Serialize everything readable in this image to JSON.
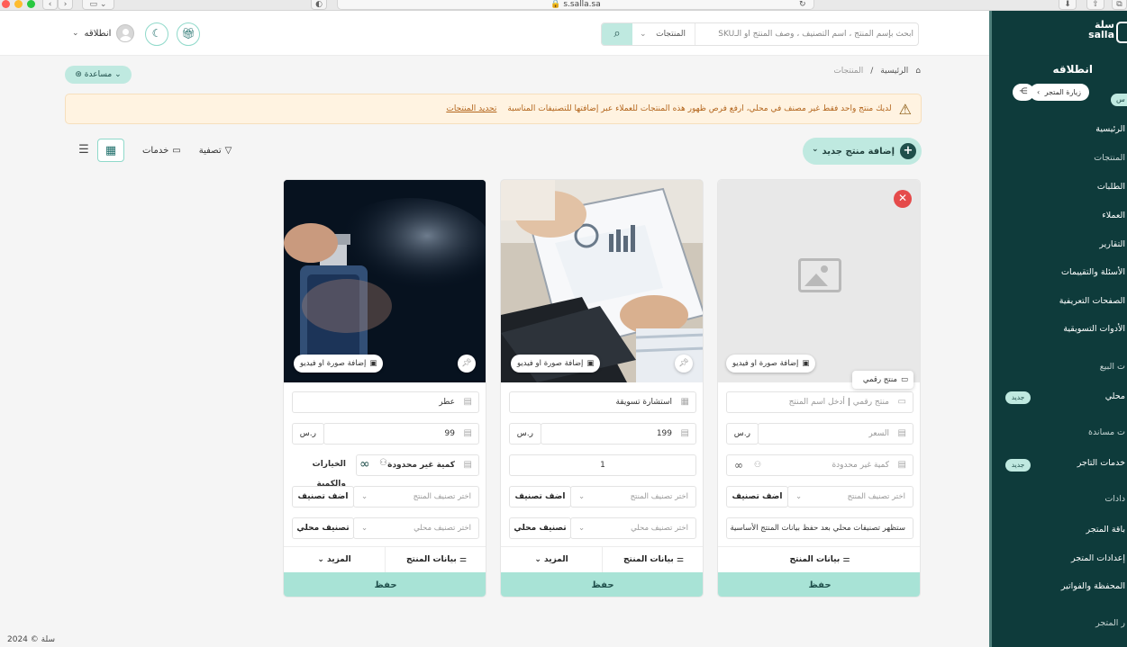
{
  "browser": {
    "url": "s.salla.sa"
  },
  "header": {
    "user_name": "انطلاقه",
    "search": {
      "placeholder": "ابحث بإسم المنتج ، اسم التصنيف ، وصف المنتج أو الـSKU",
      "category": "المنتجات"
    }
  },
  "help_label": "مساعدة",
  "breadcrumb": {
    "home": "الرئيسية",
    "separator": "/",
    "current": "المنتجات"
  },
  "alert": {
    "text": "لديك منتج واحد فقط غير مصنف في محلي، ارفع فرص ظهور هذه المنتجات للعملاء عبر إضافتها للتصنيفات المناسبة",
    "link": "تحديد المنتجات"
  },
  "toolbar": {
    "add_product": "إضافة منتج جديد",
    "filter": "تصفية",
    "services": "خدمات"
  },
  "cards": [
    {
      "media_button": "إضافة صورة او فيديو",
      "name_placeholder": "أدخل اسم المنتج",
      "name_value": "منتج رقمي",
      "price_placeholder": "السعر",
      "currency": "ر.س",
      "qty_placeholder": "كمية غير محدودة",
      "category_placeholder": "اختر تصنيف المنتج",
      "add_category": "اضف تصنيف",
      "local_note": "ستظهر تصنيفات محلي بعد حفظ بيانات المنتج الأساسية",
      "product_data": "بيانات المنتج",
      "save": "حفظ",
      "tooltip": "منتج رقمي"
    },
    {
      "media_button": "إضافة صورة او فيديو",
      "name": "استشارة تسويقة",
      "price": "199",
      "currency": "ر.س",
      "qty": "1",
      "category_placeholder": "اختر تصنيف المنتج",
      "add_category": "اضف تصنيف",
      "local_placeholder": "اختر تصنيف محلي",
      "local_btn": "تصنيف محلي",
      "product_data": "بيانات المنتج",
      "more": "المزيد",
      "save": "حفظ"
    },
    {
      "media_button": "إضافة صورة او فيديو",
      "name": "عطر",
      "price": "99",
      "currency": "ر.س",
      "qty_label": "كمية غير محدودة",
      "options": "الخيارات والكمية",
      "category_placeholder": "اختر تصنيف المنتج",
      "add_category": "اضف تصنيف",
      "local_placeholder": "اختر تصنيف محلي",
      "local_btn": "تصنيف محلي",
      "product_data": "بيانات المنتج",
      "more": "المزيد",
      "save": "حفظ"
    }
  ],
  "footer": "2024 © سلة",
  "sidebar": {
    "logo_ar": "سلة",
    "logo_en": "salla",
    "store_name": "انطلاقه",
    "visit_store": "زيارة المتجر",
    "tag": "س",
    "items": [
      {
        "label": "الرئيسية"
      },
      {
        "label": "المنتجات"
      },
      {
        "label": "الطلبات"
      },
      {
        "label": "العملاء"
      },
      {
        "label": "التقارير"
      },
      {
        "label": "الأسئلة والتقييمات"
      },
      {
        "label": "الصفحات التعريفية"
      },
      {
        "label": "الأدوات التسويقية"
      },
      {
        "label": "ت البيع"
      },
      {
        "label": "محلي",
        "badge": "جديد"
      },
      {
        "label": "ت مساندة"
      },
      {
        "label": "خدمات التاجر",
        "badge": "جديد"
      },
      {
        "label": "دادات"
      },
      {
        "label": "باقة المتجر"
      },
      {
        "label": "إعدادات المتجر"
      },
      {
        "label": "المحفظة والفواتير"
      },
      {
        "label": "ر المتجر"
      }
    ]
  },
  "colors": {
    "accent": "#bfe9e0",
    "sidebar": "#0e3b3b",
    "save": "#a8e3d6",
    "danger": "#e54b4b",
    "alert_bg": "#fff3e1"
  }
}
